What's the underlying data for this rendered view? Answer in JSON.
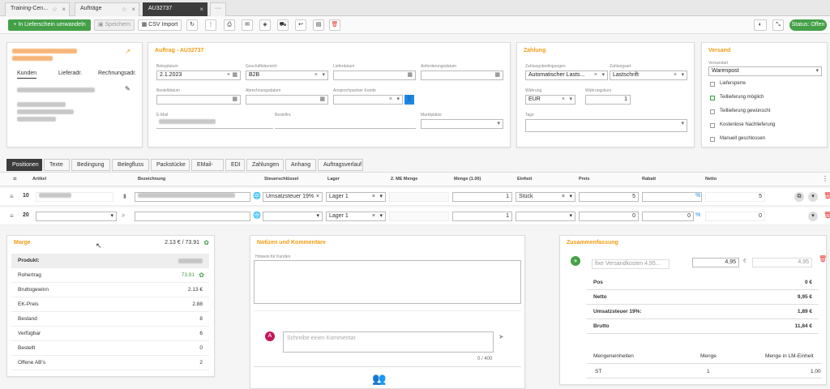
{
  "tabs": [
    {
      "label": "Training-Cen..."
    },
    {
      "label": "Aufträge"
    },
    {
      "label": "AU32737"
    }
  ],
  "tabs_more": "···",
  "toolbar": {
    "convert": "In Lieferschein umwandeln",
    "save": "Speichern",
    "csv": "CSV Import",
    "status": "Status: Offen"
  },
  "customer": {
    "tabs": [
      "Kunden",
      "Lieferadr.",
      "Rechnungsadr."
    ]
  },
  "auftrag": {
    "title": "Auftrag - AU32737",
    "belegdatum_label": "Belegdatum",
    "belegdatum": "2.1.2023",
    "geschaeftsbereich_label": "Geschäftsbereich",
    "geschaeftsbereich": "B2B",
    "lieferdatum_label": "Lieferdatum",
    "anforderungsdatum_label": "Anforderungsdatum",
    "bestelldatum_label": "Bestelldatum",
    "abrechnungsdatum_label": "Abrechnungsdatum",
    "ansprechpartner_label": "Ansprechpartner Kunde",
    "email_label": "E-Mail",
    "bestellnr_label": "Bestellnr.",
    "marktplaetze_label": "Marktplätze"
  },
  "zahlung": {
    "title": "Zahlung",
    "bedingungen_label": "Zahlungsbedingungen",
    "bedingungen": "Automatischer Lasts...",
    "zahlungsart_label": "Zahlungsart",
    "zahlungsart": "Lastschrift",
    "waehrung_label": "Währung",
    "waehrung": "EUR",
    "kurs_label": "Währungskurs",
    "kurs": "1",
    "tags_label": "Tags"
  },
  "versand": {
    "title": "Versand",
    "versandart_label": "Versandart",
    "versandart": "Warenpost",
    "options": [
      {
        "label": "Liefersperre",
        "checked": false
      },
      {
        "label": "Teillieferung möglich",
        "checked": true
      },
      {
        "label": "Teillieferung gewünscht",
        "checked": false
      },
      {
        "label": "Kostenlose Nachlieferung",
        "checked": false
      },
      {
        "label": "Manuell geschlossen",
        "checked": false
      }
    ]
  },
  "subtabs": [
    "Positionen",
    "Texte",
    "Bedingung",
    "Belegfluss",
    "Packstücke",
    "EMail-EDI",
    "EDI",
    "Zahlungen",
    "Anhang",
    "Auftragsverlauf"
  ],
  "columns": {
    "artikel": "Artikel",
    "bezeichnung": "Bezeichnung",
    "steuer": "Steuerschlüssel",
    "lager": "Lager",
    "me2": "2. ME Menge",
    "menge": "Menge (1.00)",
    "einheit": "Einheit",
    "preis": "Preis",
    "rabatt": "Rabatt",
    "netto": "Netto"
  },
  "rows": [
    {
      "pos": "10",
      "steuer": "Umsatzsteuer 19%",
      "lager": "Lager 1",
      "menge": "1",
      "einheit": "Stück",
      "preis": "5",
      "rabatt": "",
      "netto": "5"
    },
    {
      "pos": "20",
      "steuer": "",
      "lager": "Lager 1",
      "menge": "1",
      "einheit": "",
      "preis": "0",
      "rabatt": "0",
      "netto": "0"
    }
  ],
  "marge": {
    "title": "Marge",
    "summary": "2.13 € / 73.91",
    "rows": [
      {
        "label": "Produkt:",
        "value": ""
      },
      {
        "label": "Rohertrag",
        "value": "73.91"
      },
      {
        "label": "Bruttogewinn",
        "value": "2.13 €"
      },
      {
        "label": "EK-Preis",
        "value": "2.88"
      },
      {
        "label": "Bestand",
        "value": "8"
      },
      {
        "label": "Verfügbar",
        "value": "6"
      },
      {
        "label": "Bestellt",
        "value": "0"
      },
      {
        "label": "Offene AB's",
        "value": "2"
      }
    ]
  },
  "notizen": {
    "title": "Notizen und Kommentare",
    "hinweis_label": "Hinweis für Kunden",
    "avatar": "A",
    "comment_placeholder": "Schreibe einen Kommentar",
    "counter": "0 / 400"
  },
  "zusammenfassung": {
    "title": "Zusammenfassung",
    "versand_select": "fixe Versandkosten 4,95...",
    "versand_value": "4,95",
    "versand_brutto": "4,95",
    "euro": "€",
    "rows": [
      {
        "label": "Pos",
        "value": "0 €"
      },
      {
        "label": "Netto",
        "value": "9,95 €"
      },
      {
        "label": "Umsatzsteuer 19%:",
        "value": "1,89 €"
      },
      {
        "label": "Brutto",
        "value": "11,84 €"
      }
    ],
    "me_headers": [
      "Mengeneinheiten",
      "Menge",
      "Menge in LM-Einheit"
    ],
    "me_row": [
      "ST",
      "1",
      "1.00"
    ]
  },
  "colors": {
    "accent": "#f39c12",
    "green": "#43a047",
    "dark": "#3c3c3c",
    "blue": "#1e88e5",
    "red": "#e53935"
  }
}
